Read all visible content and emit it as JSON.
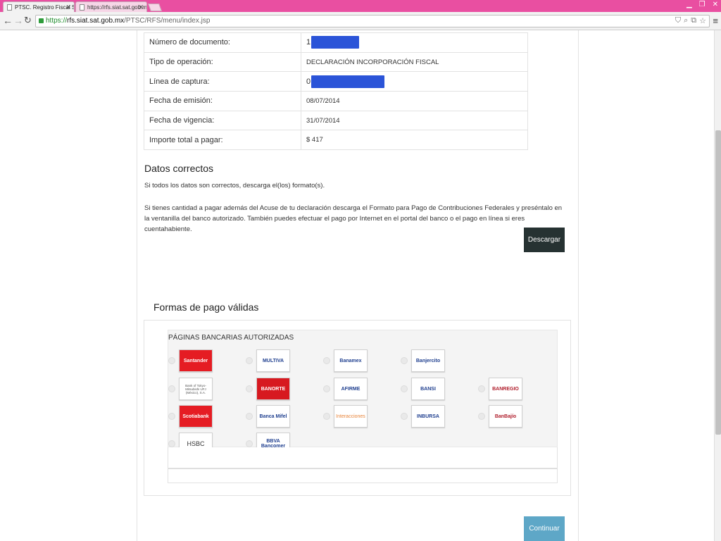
{
  "browser": {
    "tabs": [
      {
        "label": "PTSC. Registro Fiscal Simp",
        "active": true
      },
      {
        "label": "https://rfs.siat.sat.gob.mx",
        "active": false
      }
    ],
    "url_https": "https://",
    "url_host": "rfs.siat.sat.gob.mx",
    "url_path": "/PTSC/RFS/menu/index.jsp"
  },
  "document": {
    "rows": [
      {
        "label": "Número de documento:",
        "value": "1"
      },
      {
        "label": "Tipo de operación:",
        "value": "DECLARACIÓN INCORPORACIÓN FISCAL"
      },
      {
        "label": "Línea de captura:",
        "value": "0"
      },
      {
        "label": "Fecha de emisión:",
        "value": "08/07/2014"
      },
      {
        "label": "Fecha de vigencia:",
        "value": "31/07/2014"
      },
      {
        "label": "Importe total a pagar:",
        "value": "$ 417"
      }
    ]
  },
  "datos": {
    "heading": "Datos correctos",
    "line1": "Si todos los datos son correctos, descarga el(los) formato(s).",
    "line2": "Si tienes cantidad a pagar además del Acuse de tu declaración descarga el Formato para Pago de Contribuciones Federales y preséntalo en la ventanilla del banco autorizado. También puedes efectuar el pago por Internet en el portal del banco o el pago en línea si eres cuentahabiente.",
    "download_label": "Descargar"
  },
  "formas": {
    "heading": "Formas de pago válidas",
    "panel_title": "PÁGINAS BANCARIAS AUTORIZADAS",
    "banks": [
      {
        "id": "santander",
        "label": "Santander",
        "style": "red"
      },
      {
        "id": "multiva",
        "label": "MULTIVA",
        "style": "plain"
      },
      {
        "id": "banamex",
        "label": "Banamex",
        "style": "plain"
      },
      {
        "id": "banjercito",
        "label": "Banjercito",
        "style": "plain"
      },
      {
        "id": "tokyo",
        "label": "Bank of Tokyo-Mitsubishi UFJ (México), S.A.",
        "style": "plain"
      },
      {
        "id": "banorte",
        "label": "BANORTE",
        "style": "red2"
      },
      {
        "id": "afirme",
        "label": "AFIRME",
        "style": "plain"
      },
      {
        "id": "bansi",
        "label": "BANSI",
        "style": "plain"
      },
      {
        "id": "banregio",
        "label": "BANREGIO",
        "style": "plain"
      },
      {
        "id": "scotiabank",
        "label": "Scotiabank",
        "style": "red"
      },
      {
        "id": "mifel",
        "label": "Banca Mifel",
        "style": "plain"
      },
      {
        "id": "interacciones",
        "label": "Interacciones",
        "style": "plain"
      },
      {
        "id": "inbursa",
        "label": "INBURSA",
        "style": "plain"
      },
      {
        "id": "banbajio",
        "label": "BanBajío",
        "style": "plain"
      },
      {
        "id": "hsbc",
        "label": "HSBC",
        "style": "plain"
      },
      {
        "id": "bancomer",
        "label": "BBVA Bancomer",
        "style": "plain"
      }
    ]
  },
  "continue_label": "Continuar",
  "colors": {
    "titlebar": "#e94fa1",
    "dark_button": "#263232",
    "blue_button": "#5ea7c7",
    "redaction": "#2b54d8"
  }
}
